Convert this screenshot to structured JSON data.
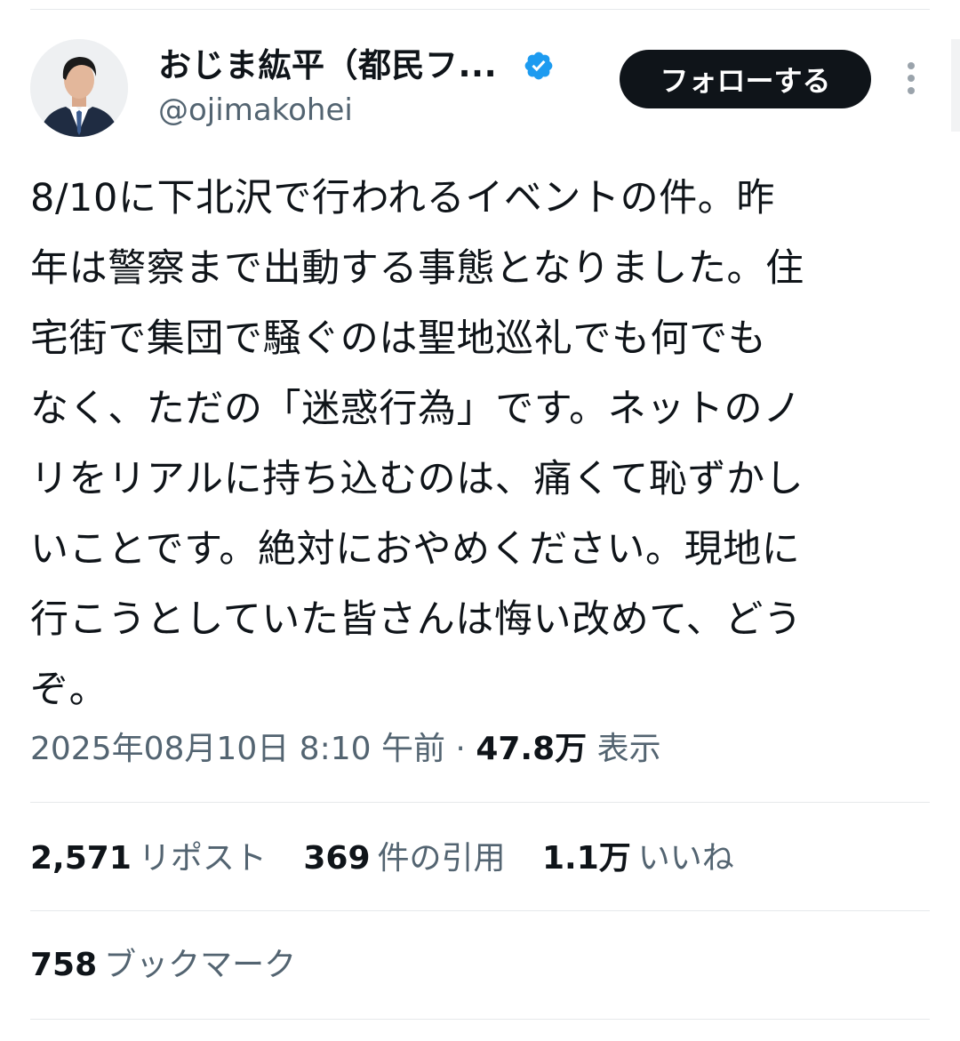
{
  "author": {
    "name": "おじま紘平（都民フ...",
    "handle": "@ojimakohei",
    "verified": true
  },
  "follow_button": {
    "label": "フォローする"
  },
  "tweet": {
    "lines": [
      "8/10に下北沢で行われるイベントの件。昨",
      "年は警察まで出動する事態となりました。住",
      "宅街で集団で騒ぐのは聖地巡礼でも何でも",
      "なく、ただの「迷惑行為」です。ネットのノ",
      "リをリアルに持ち込むのは、痛くて恥ずかし",
      "いことです。絶対におやめください。現地に",
      "行こうとしていた皆さんは悔い改めて、どう",
      "ぞ。"
    ]
  },
  "meta": {
    "timestamp": "2025年08月10日 8:10 午前",
    "separator": " · ",
    "views_count": "47.8万",
    "views_label": "表示"
  },
  "stats": {
    "reposts_count": "2,571",
    "reposts_label": "リポスト",
    "quotes_count": "369",
    "quotes_label": "件の引用",
    "likes_count": "1.1万",
    "likes_label": "いいね",
    "bookmarks_count": "758",
    "bookmarks_label": "ブックマーク"
  },
  "colors": {
    "text_primary": "#0f1419",
    "text_secondary": "#536471",
    "verified_blue": "#1d9bf0",
    "button_bg": "#0f1419",
    "divider": "#e6e9eb"
  },
  "icons": [
    "verified-badge-icon",
    "more-options-icon"
  ]
}
